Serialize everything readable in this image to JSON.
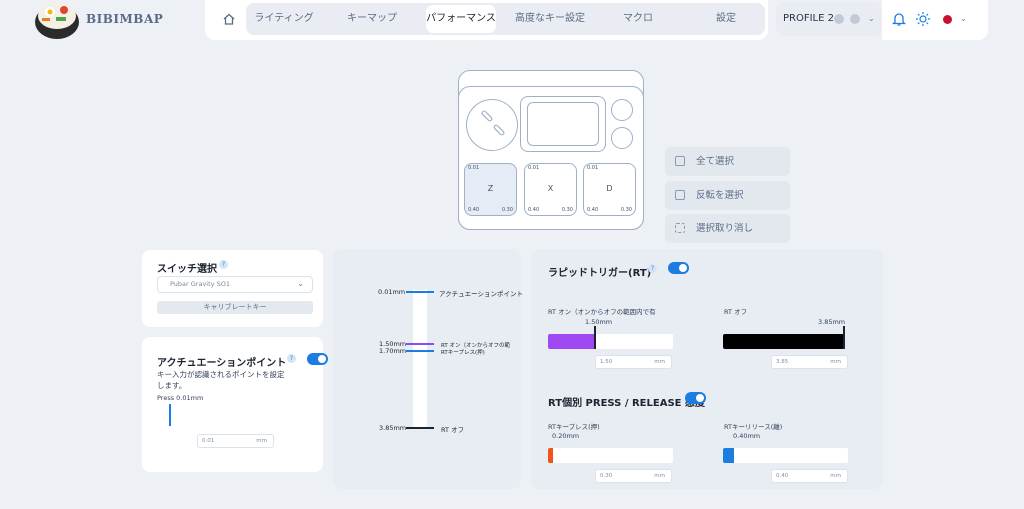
{
  "brand": "BIBIMBAP",
  "nav": [
    {
      "label": "ライティング"
    },
    {
      "label": "キーマップ"
    },
    {
      "label": "パフォーマンス",
      "active": true
    },
    {
      "label": "高度なキー設定"
    },
    {
      "label": "マクロ"
    },
    {
      "label": "設定"
    }
  ],
  "profile": {
    "label": "PROFILE 2"
  },
  "keyboard": {
    "keys": [
      {
        "label": "Z",
        "tl": "0.01",
        "bl": "0.40",
        "br": "0.30",
        "selected": true
      },
      {
        "label": "X",
        "tl": "0.01",
        "bl": "0.40",
        "br": "0.30",
        "selected": false
      },
      {
        "label": "D",
        "tl": "0.01",
        "bl": "0.40",
        "br": "0.30",
        "selected": false
      }
    ]
  },
  "selection": {
    "select_all": "全て選択",
    "invert": "反転を選択",
    "clear": "選択取り消し"
  },
  "switch": {
    "title": "スイッチ選択",
    "value": "Pubar Gravity SO1",
    "calibrate": "キャリブレートキー"
  },
  "actuation": {
    "title": "アクチュエーションポイント",
    "enabled": true,
    "desc1": "キー入力が認識されるポイントを設定",
    "desc2": "します。",
    "press_label": "Press 0.01mm",
    "input_value": "0.01",
    "unit": "mm"
  },
  "scale": {
    "items": [
      {
        "value": "0.01mm",
        "label": "アクチュエーションポイント",
        "color": "#1c7ce0"
      },
      {
        "value": "1.50mm",
        "label": "RT オン（オンからオフの範",
        "color": "#8b4cf7"
      },
      {
        "value": "1.70mm",
        "label": "RTキープレス(押)",
        "color": "#1c7ce0"
      },
      {
        "value": "3.85mm",
        "label": "RT オフ",
        "color": "#1d2330"
      }
    ]
  },
  "rt": {
    "title": "ラピッドトリガー(RT)",
    "enabled": true,
    "on": {
      "label": "RT オン（オンからオフの範囲内で有",
      "value_label": "1.50mm",
      "fraction": 0.366,
      "input": "1.50",
      "unit": "mm",
      "color": "#a049f3"
    },
    "off": {
      "label": "RT オフ",
      "value_label": "3.85mm",
      "fraction": 1.0,
      "input": "3.85",
      "unit": "mm",
      "color": "#000000"
    },
    "separate_title": "RT個別 PRESS / RELEASE 感度",
    "separate_enabled": true,
    "press": {
      "label": "RTキープレス(押)",
      "value_label": "0.20mm",
      "fraction": 0.04,
      "input": "0.30",
      "unit": "mm",
      "color": "#f2531b"
    },
    "release": {
      "label": "RTキーリリース(離)",
      "value_label": "0.40mm",
      "fraction": 0.09,
      "input": "0.40",
      "unit": "mm",
      "color": "#1c7ce0"
    }
  }
}
